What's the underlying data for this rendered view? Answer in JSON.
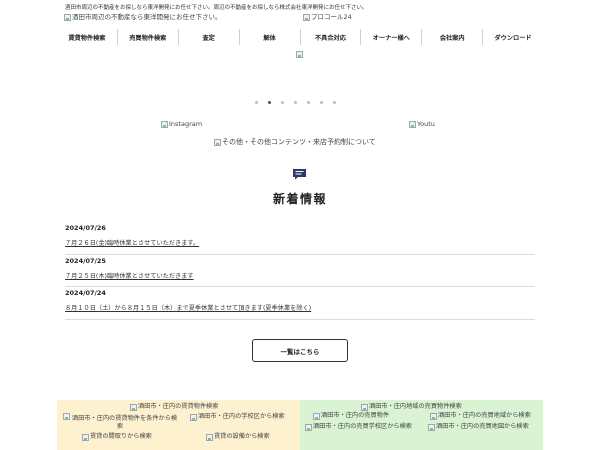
{
  "tagline": "酒田市周辺の不動産をお探しなら東洋開発にお任せ下さい。周辺の不動産をお探しなら株式会社東洋開発にお任せ下さい。",
  "header": {
    "logo_alt": "酒田市周辺の不動産なら東洋開発にお任せ下さい。",
    "partner_alt": "プロコール24"
  },
  "nav": [
    "賃貸物件検索",
    "売買物件検索",
    "査定",
    "解体",
    "不具合対応",
    "オーナー様へ",
    "会社案内",
    "ダウンロード"
  ],
  "slider": {
    "count": 7,
    "active": 1
  },
  "social": {
    "instagram_alt": "Instagram",
    "youtube_alt": "Youtu"
  },
  "other_alt": "その他・その他コンテンツ・来店予約制について",
  "news": {
    "icon": "chat-bubble-icon",
    "title": "新着情報",
    "items": [
      {
        "date": "2024/07/26",
        "text": "７月２６日(金)臨時休業とさせていただきます。"
      },
      {
        "date": "2024/07/25",
        "text": "７月２５日(木)臨時休業とさせていただきます"
      },
      {
        "date": "2024/07/24",
        "text": "８月１０日（土）から８月１５日（木）まで夏季休業とさせて頂きます(夏季休業を除く)"
      }
    ],
    "more_label": "一覧はこちら"
  },
  "rental_panel": {
    "title_alt": "酒田市・庄内の賃貸物件検索",
    "condition_alt": "酒田市・庄内の賃貸物件を条件から検索",
    "school_alt": "酒田市・庄内の学校区から検索",
    "layout_alt": "賃貸の間取りから検索",
    "equip_alt": "賃貸の設備から検索"
  },
  "sale_panel": {
    "title_alt": "酒田市・庄内地域の売買物件検索",
    "area_alt": "酒田市・庄内の売買物件",
    "area2_alt": "酒田市・庄内の売買地域から検索",
    "school_alt": "酒田市・庄内の売買学校区から検索",
    "map_alt": "酒田市・庄内の売買地図から検索"
  },
  "colors": {
    "rental_bg": "#fdf1cf",
    "sale_bg": "#d9f3d3",
    "icon": "#2b3a6b"
  }
}
